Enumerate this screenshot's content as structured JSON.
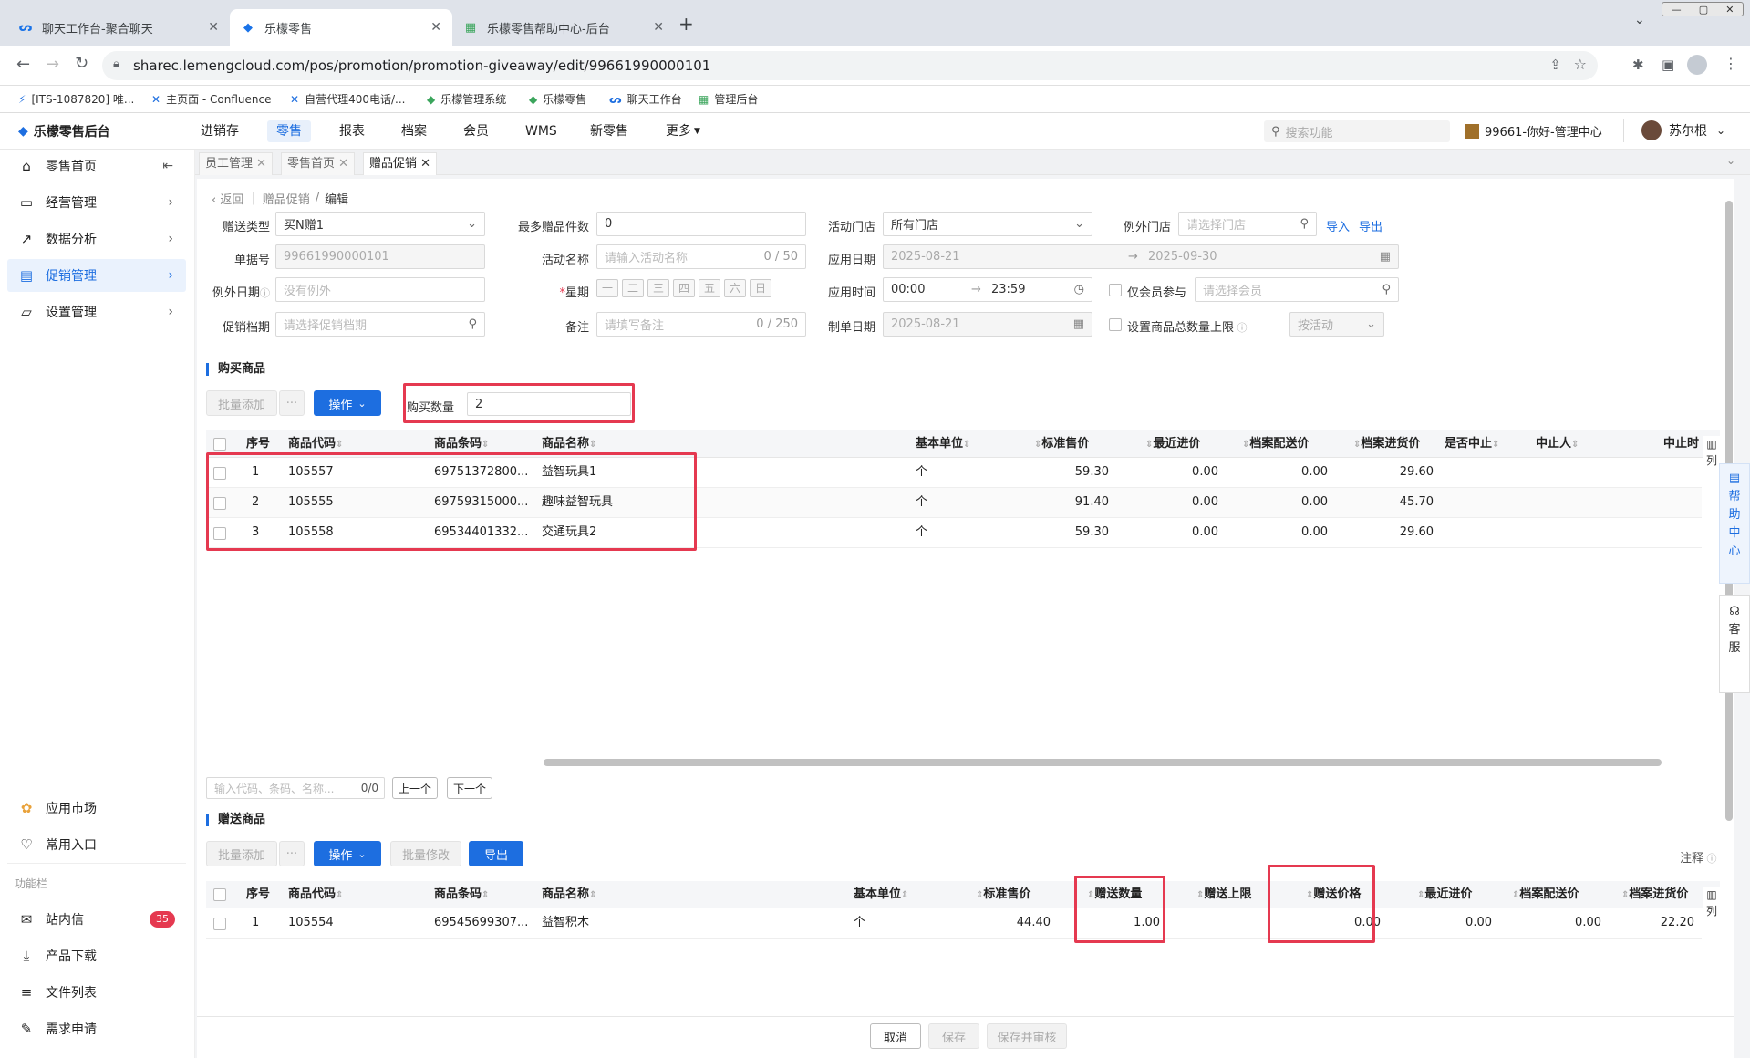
{
  "browser": {
    "tabs": [
      {
        "title": "聊天工作台-聚合聊天",
        "active": false
      },
      {
        "title": "乐檬零售",
        "active": true
      },
      {
        "title": "乐檬零售帮助中心-后台",
        "active": false
      }
    ],
    "url": "sharec.lemengcloud.com/pos/promotion/promotion-giveaway/edit/99661990000101",
    "bookmarks": [
      "[ITS-1087820] 唯...",
      "主页面 - Confluence",
      "自营代理400电话/...",
      "乐檬管理系统",
      "乐檬零售",
      "聊天工作台",
      "管理后台"
    ]
  },
  "app": {
    "logo": "乐檬零售后台",
    "nav": [
      "进销存",
      "零售",
      "报表",
      "档案",
      "会员",
      "WMS",
      "新零售",
      "更多"
    ],
    "active_nav": "零售",
    "search_placeholder": "搜索功能",
    "store": "99661-你好-管理中心",
    "user": "苏尔根"
  },
  "sidebar": {
    "items": [
      {
        "label": "零售首页",
        "icon": "home-icon"
      },
      {
        "label": "经营管理",
        "icon": "monitor-icon"
      },
      {
        "label": "数据分析",
        "icon": "chart-icon"
      },
      {
        "label": "促销管理",
        "icon": "promo-icon"
      },
      {
        "label": "设置管理",
        "icon": "folder-icon"
      }
    ],
    "bottom": [
      "应用市场",
      "常用入口"
    ],
    "section": "功能栏",
    "tools": [
      "站内信",
      "产品下载",
      "文件列表",
      "需求申请"
    ],
    "badge": "35"
  },
  "pagetabs": [
    "员工管理",
    "零售首页",
    "赠品促销"
  ],
  "breadcrumb": {
    "back": "返回",
    "parent": "赠品促销",
    "current": "编辑"
  },
  "form": {
    "gift_type_label": "赠送类型",
    "gift_type": "买N赠1",
    "max_gift_label": "最多赠品件数",
    "max_gift": "0",
    "store_label": "活动门店",
    "store": "所有门店",
    "except_store_label": "例外门店",
    "except_store_ph": "请选择门店",
    "import": "导入",
    "export": "导出",
    "bill_no_label": "单据号",
    "bill_no": "99661990000101",
    "name_label": "活动名称",
    "name_ph": "请输入活动名称",
    "name_count": "0 / 50",
    "date_label": "应用日期",
    "date_start": "2025-08-21",
    "date_end": "2025-09-30",
    "except_date_label": "例外日期",
    "except_date_ph": "没有例外",
    "week_label": "星期",
    "weeks": [
      "一",
      "二",
      "三",
      "四",
      "五",
      "六",
      "日"
    ],
    "time_label": "应用时间",
    "time_start": "00:00",
    "time_end": "23:59",
    "member_only": "仅会员参与",
    "member_ph": "请选择会员",
    "grade_label": "促销档期",
    "grade_ph": "请选择促销档期",
    "remark_label": "备注",
    "remark_ph": "请填写备注",
    "remark_count": "0 / 250",
    "made_date_label": "制单日期",
    "made_date": "2025-08-21",
    "limit_label": "设置商品总数量上限",
    "limit_mode": "按活动"
  },
  "buy": {
    "title": "购买商品",
    "batch_add": "批量添加",
    "more": "···",
    "operate": "操作",
    "qty_label": "购买数量",
    "qty": "2",
    "headers": [
      "序号",
      "商品代码",
      "商品条码",
      "商品名称",
      "基本单位",
      "标准售价",
      "最近进价",
      "档案配送价",
      "档案进货价",
      "是否中止",
      "中止人",
      "中止时"
    ],
    "col_toggle": "列",
    "rows": [
      {
        "no": "1",
        "code": "105557",
        "barcode": "69751372800...",
        "name": "益智玩具1",
        "unit": "个",
        "price": "59.30",
        "last_in": "0.00",
        "dist": "0.00",
        "purchase": "29.60"
      },
      {
        "no": "2",
        "code": "105555",
        "barcode": "69759315000...",
        "name": "趣味益智玩具",
        "unit": "个",
        "price": "91.40",
        "last_in": "0.00",
        "dist": "0.00",
        "purchase": "45.70"
      },
      {
        "no": "3",
        "code": "105558",
        "barcode": "69534401332...",
        "name": "交通玩具2",
        "unit": "个",
        "price": "59.30",
        "last_in": "0.00",
        "dist": "0.00",
        "purchase": "29.60"
      }
    ],
    "search_ph": "输入代码、条码、名称...",
    "search_count": "0/0",
    "prev": "上一个",
    "next": "下一个"
  },
  "gift": {
    "title": "赠送商品",
    "batch_add": "批量添加",
    "more": "···",
    "operate": "操作",
    "batch_edit": "批量修改",
    "export": "导出",
    "note": "注释",
    "headers": [
      "序号",
      "商品代码",
      "商品条码",
      "商品名称",
      "基本单位",
      "标准售价",
      "赠送数量",
      "赠送上限",
      "赠送价格",
      "最近进价",
      "档案配送价",
      "档案进货价"
    ],
    "col_toggle": "列",
    "rows": [
      {
        "no": "1",
        "code": "105554",
        "barcode": "69545699307...",
        "name": "益智积木",
        "unit": "个",
        "price": "44.40",
        "qty": "1.00",
        "limit": "",
        "gift_price": "0.00",
        "last_in": "0.00",
        "dist": "0.00",
        "purchase": "22.20"
      }
    ]
  },
  "footer": {
    "cancel": "取消",
    "save": "保存",
    "save_audit": "保存并审核"
  },
  "rightbar": {
    "help": "帮助中心",
    "service": "客服"
  },
  "colors": {
    "accent": "#1d6ee0",
    "highlight": "#e53950"
  }
}
